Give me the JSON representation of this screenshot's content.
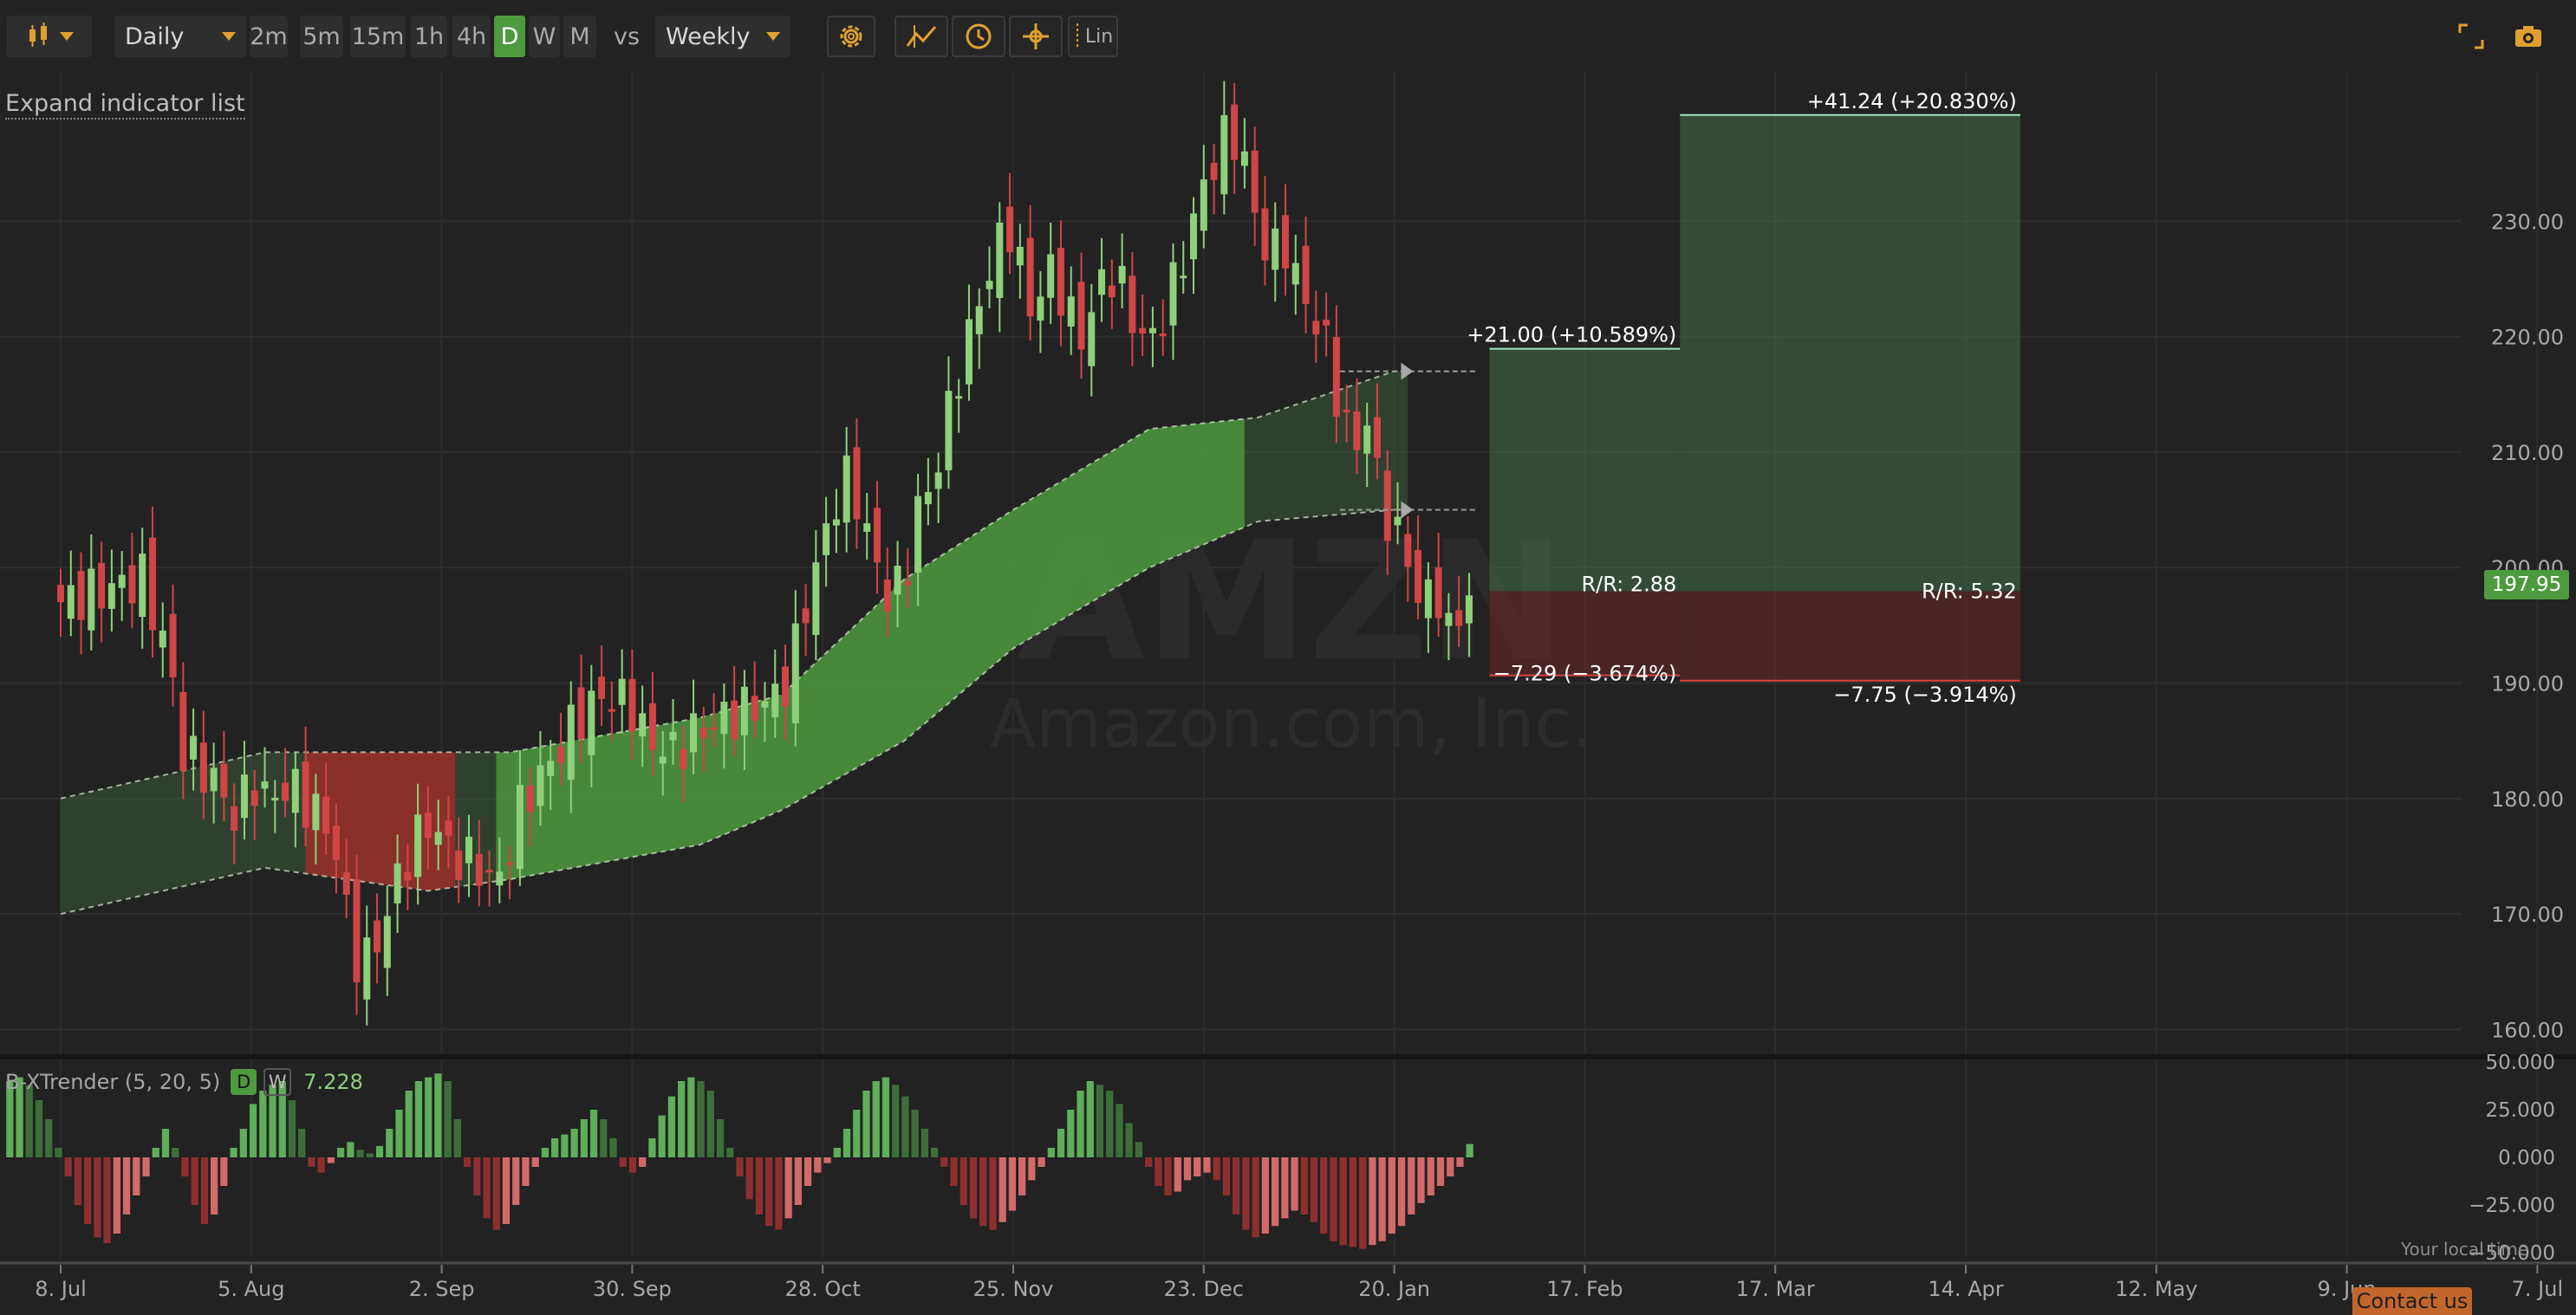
{
  "toolbar": {
    "chart_type_icon": "candlestick-icon",
    "interval_select": "Daily",
    "timeframes": [
      "2m",
      "5m",
      "15m",
      "1h",
      "4h",
      "D",
      "W",
      "M"
    ],
    "active_timeframe": "D",
    "vs_label": "vs",
    "compare_select": "Weekly",
    "tools": [
      "gear-icon",
      "drawing-tool-icon",
      "clock-icon",
      "crosshair-icon"
    ],
    "scale_label": "Lin",
    "right_tools": [
      "fullscreen-icon",
      "camera-icon"
    ]
  },
  "expand_indicator_list": "Expand indicator list",
  "watermark": {
    "ticker": "AMZN",
    "company": "Amazon.com, Inc."
  },
  "current_price": "197.95",
  "local_time_label": "Your local time",
  "contact_label": "Contact us",
  "colors": {
    "up": "#8fd07a",
    "down": "#d04545",
    "accent": "#e0a030",
    "band_green": "#4e9a3f",
    "band_red": "#a8342e"
  },
  "chart_data": {
    "type": "candlestick",
    "title": "",
    "ylim": [
      158,
      243
    ],
    "y_ticks": [
      160,
      170,
      180,
      190,
      200,
      210,
      220,
      230
    ],
    "y_tick_labels": [
      "160.00",
      "170.00",
      "180.00",
      "190.00",
      "200.00",
      "210.00",
      "220.00",
      "230.00"
    ],
    "x_tick_labels": [
      "8. Jul",
      "5. Aug",
      "2. Sep",
      "30. Sep",
      "28. Oct",
      "25. Nov",
      "23. Dec",
      "20. Jan",
      "17. Feb",
      "17. Mar",
      "14. Apr",
      "12. May",
      "9. Jun",
      "7. Jul"
    ],
    "close_path": [
      [
        0,
        197
      ],
      [
        6,
        198
      ],
      [
        12,
        199
      ],
      [
        16,
        192
      ],
      [
        18,
        184
      ],
      [
        22,
        182
      ],
      [
        24,
        180
      ],
      [
        26,
        178
      ],
      [
        28,
        182
      ],
      [
        30,
        180
      ],
      [
        34,
        181
      ],
      [
        40,
        177
      ],
      [
        42,
        170
      ],
      [
        44,
        165
      ],
      [
        46,
        167
      ],
      [
        48,
        170
      ],
      [
        50,
        174
      ],
      [
        52,
        176
      ],
      [
        54,
        178
      ],
      [
        58,
        175
      ],
      [
        62,
        174
      ],
      [
        64,
        172
      ],
      [
        66,
        176
      ],
      [
        68,
        180
      ],
      [
        72,
        183
      ],
      [
        76,
        187
      ],
      [
        80,
        189
      ],
      [
        84,
        188
      ],
      [
        86,
        185
      ],
      [
        90,
        184
      ],
      [
        94,
        186
      ],
      [
        98,
        187
      ],
      [
        102,
        188
      ],
      [
        106,
        189
      ],
      [
        108,
        193
      ],
      [
        110,
        198
      ],
      [
        112,
        202
      ],
      [
        114,
        206
      ],
      [
        116,
        208
      ],
      [
        118,
        204
      ],
      [
        120,
        200
      ],
      [
        122,
        197
      ],
      [
        124,
        199
      ],
      [
        126,
        205
      ],
      [
        128,
        207
      ],
      [
        130,
        212
      ],
      [
        132,
        217
      ],
      [
        134,
        221
      ],
      [
        136,
        225
      ],
      [
        138,
        228
      ],
      [
        140,
        230
      ],
      [
        142,
        222
      ],
      [
        144,
        224
      ],
      [
        146,
        226
      ],
      [
        148,
        222
      ],
      [
        150,
        220
      ],
      [
        152,
        223
      ],
      [
        154,
        226
      ],
      [
        156,
        224
      ],
      [
        158,
        221
      ],
      [
        160,
        219
      ],
      [
        162,
        222
      ],
      [
        164,
        225
      ],
      [
        166,
        229
      ],
      [
        168,
        233
      ],
      [
        170,
        236
      ],
      [
        172,
        238
      ],
      [
        174,
        235
      ],
      [
        176,
        229
      ],
      [
        178,
        227
      ],
      [
        180,
        228
      ],
      [
        182,
        224
      ],
      [
        184,
        222
      ],
      [
        186,
        219
      ],
      [
        188,
        214
      ],
      [
        190,
        210
      ],
      [
        192,
        213
      ],
      [
        194,
        206
      ],
      [
        196,
        203
      ],
      [
        198,
        201
      ],
      [
        200,
        196
      ],
      [
        202,
        199
      ],
      [
        204,
        194
      ],
      [
        206,
        197
      ],
      [
        208,
        198
      ]
    ],
    "candle_colors": "alternating-by-direction",
    "band": {
      "upper": [
        [
          0,
          180
        ],
        [
          30,
          184
        ],
        [
          54,
          184
        ],
        [
          66,
          184
        ],
        [
          94,
          187
        ],
        [
          106,
          189
        ],
        [
          124,
          199
        ],
        [
          140,
          205
        ],
        [
          160,
          212
        ],
        [
          176,
          213
        ],
        [
          196,
          217
        ],
        [
          198,
          217
        ]
      ],
      "lower": [
        [
          0,
          170
        ],
        [
          30,
          174
        ],
        [
          54,
          172
        ],
        [
          66,
          173
        ],
        [
          94,
          176
        ],
        [
          106,
          179
        ],
        [
          124,
          185
        ],
        [
          140,
          193
        ],
        [
          160,
          200
        ],
        [
          176,
          204
        ],
        [
          196,
          205
        ],
        [
          198,
          205
        ]
      ],
      "segments": [
        {
          "from": 0,
          "to": 36,
          "state": "neutral"
        },
        {
          "from": 36,
          "to": 58,
          "state": "bearish"
        },
        {
          "from": 58,
          "to": 64,
          "state": "neutral"
        },
        {
          "from": 64,
          "to": 174,
          "state": "bullish"
        },
        {
          "from": 174,
          "to": 198,
          "state": "neutral"
        }
      ]
    },
    "position_tools": [
      {
        "entry": 197.95,
        "target": 218.95,
        "stop": 190.66,
        "target_label": "+21.00 (+10.589%)",
        "stop_label": "−7.29 (−3.674%)",
        "rr_label": "R/R: 2.88",
        "from_day": 210,
        "to_day": 238
      },
      {
        "entry": 197.95,
        "target": 239.19,
        "stop": 190.2,
        "target_label": "+41.24 (+20.830%)",
        "stop_label": "−7.75 (−3.914%)",
        "rr_label": "R/R: 5.32",
        "from_day": 238,
        "to_day": 288
      }
    ],
    "alert_markers": [
      217,
      205
    ],
    "indicator": {
      "name": "B-XTrender (5, 20, 5)",
      "badges": [
        "D",
        "W"
      ],
      "value": "7.228",
      "ylim": [
        -50,
        50
      ],
      "y_ticks": [
        50,
        25,
        0,
        -25,
        -50
      ],
      "y_tick_labels": [
        "50.000",
        "25.000",
        "0.000",
        "−25.000",
        "−50.000"
      ],
      "histogram": [
        40,
        42,
        38,
        30,
        20,
        5,
        -10,
        -25,
        -35,
        -42,
        -45,
        -40,
        -30,
        -20,
        -10,
        5,
        15,
        5,
        -10,
        -25,
        -35,
        -30,
        -15,
        5,
        15,
        28,
        35,
        38,
        40,
        30,
        15,
        -5,
        -8,
        -3,
        5,
        8,
        4,
        2,
        6,
        15,
        25,
        35,
        40,
        42,
        44,
        40,
        20,
        -5,
        -20,
        -32,
        -38,
        -35,
        -25,
        -15,
        -5,
        5,
        10,
        12,
        15,
        20,
        25,
        20,
        10,
        -5,
        -8,
        -5,
        10,
        22,
        32,
        40,
        42,
        40,
        35,
        20,
        5,
        -10,
        -22,
        -30,
        -36,
        -38,
        -32,
        -25,
        -15,
        -8,
        -3,
        5,
        15,
        25,
        35,
        40,
        42,
        38,
        32,
        25,
        15,
        5,
        -5,
        -15,
        -25,
        -32,
        -36,
        -38,
        -34,
        -28,
        -20,
        -12,
        -5,
        5,
        15,
        25,
        35,
        40,
        38,
        35,
        28,
        18,
        8,
        -5,
        -15,
        -20,
        -18,
        -12,
        -10,
        -8,
        -12,
        -20,
        -30,
        -38,
        -42,
        -40,
        -36,
        -32,
        -28,
        -30,
        -34,
        -40,
        -44,
        -46,
        -47,
        -48,
        -46,
        -44,
        -40,
        -36,
        -30,
        -24,
        -20,
        -15,
        -10,
        -5,
        7
      ]
    }
  }
}
